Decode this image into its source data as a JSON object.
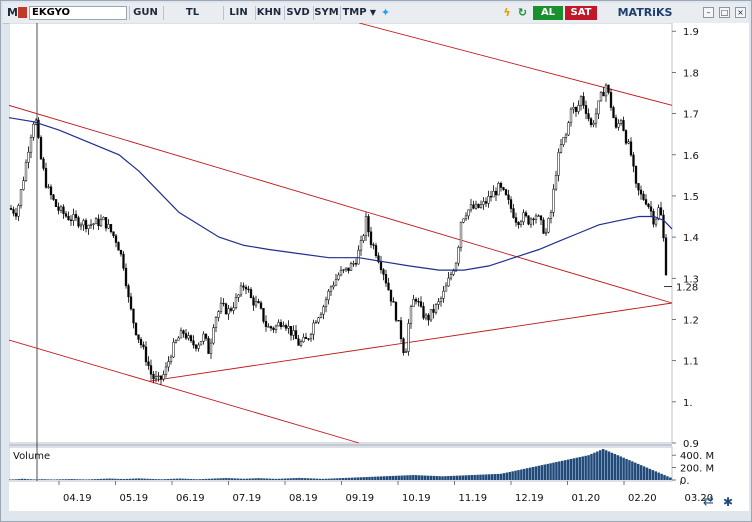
{
  "toolbar": {
    "menu_label": "M",
    "symbol": "EKGYO",
    "buttons": [
      "GUN",
      "TL",
      "LIN",
      "KHN",
      "SVD",
      "SYM",
      "TMP"
    ],
    "buy_label": "AL",
    "sell_label": "SAT",
    "brand": "MATRiKS",
    "icon_names": [
      "menu-icon",
      "dropdown-icon",
      "twitter-icon",
      "lightning-icon",
      "refresh-icon",
      "minimize-icon",
      "maximize-icon",
      "close-icon"
    ]
  },
  "colors": {
    "up_candle": "#000000",
    "moving_average": "#1f2f8f",
    "channel": "#c0181a",
    "volume": "#1f4a7a",
    "last_price_line": "#333333"
  },
  "chart_data": [
    {
      "type": "candlestick",
      "symbol": "EKGYO",
      "x_tick_labels": [
        "04.19",
        "05.19",
        "06.19",
        "07.19",
        "08.19",
        "09.19",
        "10.19",
        "11.19",
        "12.19",
        "01.20",
        "02.20",
        "03.20"
      ],
      "y_tick_labels": [
        "1.9",
        "1.8",
        "1.7",
        "1.6",
        "1.5",
        "1.4",
        "1.3",
        "1.2",
        "1.1",
        "1.",
        "0.9"
      ],
      "ylim": [
        0.9,
        1.92
      ],
      "last_price": 1.28,
      "last_price_label": "1.28",
      "grid": false,
      "close_path": [
        [
          0,
          1.47
        ],
        [
          8,
          1.46
        ],
        [
          15,
          1.55
        ],
        [
          21,
          1.64
        ],
        [
          26,
          1.7
        ],
        [
          31,
          1.6
        ],
        [
          38,
          1.52
        ],
        [
          48,
          1.47
        ],
        [
          58,
          1.45
        ],
        [
          68,
          1.44
        ],
        [
          80,
          1.43
        ],
        [
          95,
          1.44
        ],
        [
          108,
          1.39
        ],
        [
          115,
          1.33
        ],
        [
          120,
          1.24
        ],
        [
          126,
          1.18
        ],
        [
          132,
          1.14
        ],
        [
          138,
          1.1
        ],
        [
          143,
          1.06
        ],
        [
          150,
          1.05
        ],
        [
          156,
          1.07
        ],
        [
          162,
          1.12
        ],
        [
          168,
          1.15
        ],
        [
          175,
          1.17
        ],
        [
          182,
          1.14
        ],
        [
          188,
          1.14
        ],
        [
          195,
          1.16
        ],
        [
          200,
          1.12
        ],
        [
          205,
          1.2
        ],
        [
          212,
          1.23
        ],
        [
          220,
          1.22
        ],
        [
          228,
          1.25
        ],
        [
          236,
          1.29
        ],
        [
          242,
          1.25
        ],
        [
          250,
          1.23
        ],
        [
          258,
          1.18
        ],
        [
          266,
          1.18
        ],
        [
          274,
          1.2
        ],
        [
          282,
          1.17
        ],
        [
          290,
          1.14
        ],
        [
          298,
          1.15
        ],
        [
          306,
          1.2
        ],
        [
          314,
          1.23
        ],
        [
          322,
          1.28
        ],
        [
          330,
          1.31
        ],
        [
          338,
          1.32
        ],
        [
          346,
          1.34
        ],
        [
          352,
          1.38
        ],
        [
          357,
          1.44
        ],
        [
          362,
          1.39
        ],
        [
          368,
          1.36
        ],
        [
          374,
          1.32
        ],
        [
          380,
          1.27
        ],
        [
          386,
          1.22
        ],
        [
          392,
          1.16
        ],
        [
          396,
          1.11
        ],
        [
          400,
          1.2
        ],
        [
          406,
          1.26
        ],
        [
          412,
          1.22
        ],
        [
          418,
          1.2
        ],
        [
          424,
          1.22
        ],
        [
          430,
          1.24
        ],
        [
          436,
          1.27
        ],
        [
          442,
          1.31
        ],
        [
          448,
          1.35
        ],
        [
          452,
          1.44
        ],
        [
          456,
          1.46
        ],
        [
          462,
          1.47
        ],
        [
          468,
          1.47
        ],
        [
          475,
          1.48
        ],
        [
          482,
          1.5
        ],
        [
          490,
          1.52
        ],
        [
          496,
          1.5
        ],
        [
          502,
          1.47
        ],
        [
          508,
          1.44
        ],
        [
          514,
          1.45
        ],
        [
          520,
          1.44
        ],
        [
          526,
          1.46
        ],
        [
          532,
          1.43
        ],
        [
          537,
          1.41
        ],
        [
          542,
          1.46
        ],
        [
          548,
          1.58
        ],
        [
          553,
          1.63
        ],
        [
          558,
          1.65
        ],
        [
          562,
          1.72
        ],
        [
          567,
          1.7
        ],
        [
          572,
          1.74
        ],
        [
          577,
          1.71
        ],
        [
          582,
          1.67
        ],
        [
          587,
          1.7
        ],
        [
          592,
          1.74
        ],
        [
          597,
          1.77
        ],
        [
          602,
          1.72
        ],
        [
          607,
          1.66
        ],
        [
          612,
          1.69
        ],
        [
          617,
          1.64
        ],
        [
          622,
          1.6
        ],
        [
          627,
          1.52
        ],
        [
          632,
          1.5
        ],
        [
          637,
          1.49
        ],
        [
          641,
          1.47
        ],
        [
          645,
          1.44
        ],
        [
          647,
          1.45
        ],
        [
          649,
          1.47
        ],
        [
          651,
          1.46
        ],
        [
          653,
          1.44
        ],
        [
          655,
          1.38
        ],
        [
          657,
          1.32
        ],
        [
          659,
          1.28
        ]
      ],
      "moving_average": [
        [
          0,
          1.69
        ],
        [
          25,
          1.68
        ],
        [
          50,
          1.66
        ],
        [
          80,
          1.63
        ],
        [
          110,
          1.6
        ],
        [
          130,
          1.56
        ],
        [
          150,
          1.51
        ],
        [
          170,
          1.46
        ],
        [
          190,
          1.43
        ],
        [
          210,
          1.4
        ],
        [
          235,
          1.38
        ],
        [
          260,
          1.37
        ],
        [
          290,
          1.36
        ],
        [
          320,
          1.35
        ],
        [
          350,
          1.35
        ],
        [
          375,
          1.34
        ],
        [
          400,
          1.33
        ],
        [
          430,
          1.32
        ],
        [
          455,
          1.32
        ],
        [
          480,
          1.33
        ],
        [
          505,
          1.35
        ],
        [
          530,
          1.37
        ],
        [
          550,
          1.39
        ],
        [
          570,
          1.41
        ],
        [
          590,
          1.43
        ],
        [
          610,
          1.44
        ],
        [
          630,
          1.45
        ],
        [
          645,
          1.45
        ],
        [
          655,
          1.44
        ],
        [
          663,
          1.42
        ]
      ],
      "channel_lines": [
        {
          "from": [
            0,
            1.72
          ],
          "to": [
            663,
            1.24
          ]
        },
        {
          "from": [
            0,
            1.15
          ],
          "to": [
            350,
            0.9
          ]
        },
        {
          "from": [
            350,
            1.92
          ],
          "to": [
            663,
            1.72
          ]
        },
        {
          "from": [
            140,
            1.05
          ],
          "to": [
            663,
            1.24
          ]
        }
      ]
    },
    {
      "type": "bar",
      "title": "Volume",
      "y_tick_labels": [
        "400. M",
        "200. M",
        "0."
      ],
      "ylim": [
        0,
        500
      ],
      "values": [
        8,
        10,
        12,
        15,
        20,
        18,
        14,
        12,
        10,
        9,
        11,
        13,
        12,
        10,
        9,
        8,
        10,
        11,
        12,
        13,
        14,
        15,
        14,
        12,
        11,
        10,
        9,
        10,
        12,
        14,
        16,
        18,
        20,
        22,
        24,
        22,
        20,
        18,
        17,
        16,
        18,
        20,
        22,
        24,
        26,
        24,
        22,
        20,
        18,
        16,
        14,
        13,
        12,
        14,
        16,
        18,
        20,
        22,
        24,
        22,
        20,
        18,
        16,
        14,
        12,
        14,
        16,
        18,
        20,
        22,
        24,
        26,
        28,
        30,
        32,
        30,
        28,
        26,
        24,
        22,
        20,
        22,
        24,
        26,
        28,
        30,
        28,
        26,
        24,
        22,
        20,
        18,
        20,
        22,
        24,
        26,
        28,
        30,
        32,
        34,
        32,
        30,
        28,
        26,
        24,
        22,
        20,
        18,
        20,
        22,
        24,
        26,
        28,
        30,
        32,
        34,
        36,
        38,
        40,
        42,
        44,
        46,
        48,
        50,
        52,
        54,
        56,
        58,
        60,
        62,
        64,
        66,
        68,
        70,
        72,
        74,
        76,
        78,
        80,
        78,
        76,
        74,
        72,
        70,
        68,
        66,
        64,
        62,
        60,
        62,
        64,
        66,
        68,
        70,
        72,
        74,
        76,
        78,
        80,
        82,
        84,
        86,
        88,
        90,
        92,
        94,
        96,
        98,
        100,
        110,
        120,
        130,
        140,
        150,
        160,
        170,
        180,
        190,
        200,
        210,
        220,
        230,
        240,
        250,
        260,
        270,
        280,
        290,
        300,
        310,
        320,
        330,
        340,
        350,
        360,
        370,
        380,
        390,
        400,
        420,
        440,
        460,
        480,
        500,
        480,
        460,
        440,
        420,
        400,
        380,
        360,
        340,
        320,
        300,
        280,
        260,
        240,
        220,
        200,
        180,
        160,
        140,
        120,
        100,
        80,
        60,
        40
      ]
    }
  ]
}
